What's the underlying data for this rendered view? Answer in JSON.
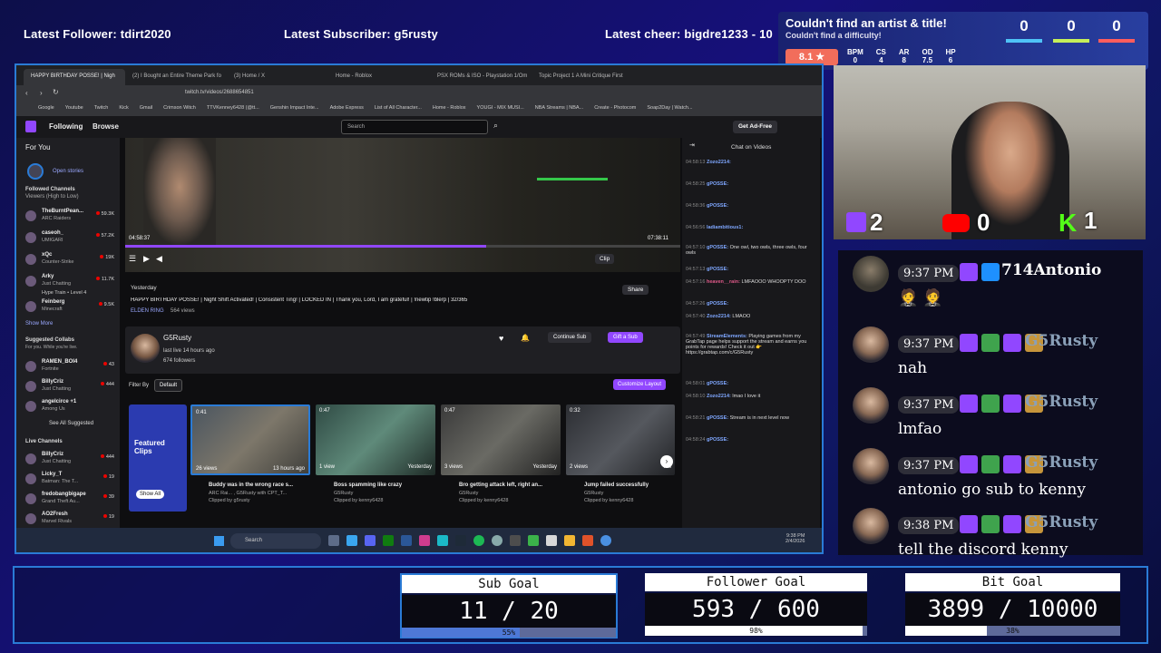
{
  "stream_overlay": {
    "latest_follower": "Latest Follower: tdirt2020",
    "latest_subscriber": "Latest Subscriber: g5rusty",
    "latest_cheer": "Latest cheer: bigdre1233 - 10"
  },
  "game_overlay": {
    "title": "Couldn't find an artist & title!",
    "subtitle": "Couldn't find a difficulty!",
    "star_rating": "8.1 ★",
    "stats": [
      {
        "label": "BPM",
        "value": "0"
      },
      {
        "label": "CS",
        "value": "4"
      },
      {
        "label": "AR",
        "value": "8"
      },
      {
        "label": "OD",
        "value": "7.5"
      },
      {
        "label": "HP",
        "value": "6"
      }
    ],
    "counters": [
      "0",
      "0",
      "0"
    ],
    "counter_colors": [
      "#4fc3f7",
      "#c6ef5a",
      "#ff5d5d"
    ]
  },
  "webcam_counters": {
    "twitch": "2",
    "youtube": "0",
    "kick": "1"
  },
  "browser": {
    "tabs": [
      "HAPPY BIRTHDAY POSSE! | Nigh",
      "(2) I Bought an Entire Theme Park fo",
      "(3) Home / X",
      "Home - Roblox",
      "PSX ROMs & ISO - Playstation 1/Om",
      "Topic Project 1 A Mini Critique First"
    ],
    "url": "twitch.tv/videos/2688654851",
    "bookmarks": [
      "Google",
      "Youtube",
      "Twitch",
      "Kick",
      "Gmail",
      "Crimson Witch",
      "TTVKenney6428 (@tt...",
      "Genshin Impact Inte...",
      "Adobe Express",
      "List of All Character...",
      "Home - Roblox",
      "YOUGI - MIX MUSI...",
      "NBA Streams | NBA...",
      "Create - Photocom",
      "Soap2Day | Watch..."
    ]
  },
  "twitch": {
    "nav": {
      "following": "Following",
      "browse": "Browse",
      "search_placeholder": "Search",
      "get_ad_free": "Get Ad-Free"
    },
    "sidebar": {
      "for_you": "For You",
      "open_stories": "Open stories",
      "followed_channels": "Followed Channels",
      "followed_sort": "Viewers (High to Low)",
      "followed": [
        {
          "name": "TheBurntPean...",
          "game": "ARC Raiders",
          "count": "59.3K"
        },
        {
          "name": "caseoh_",
          "game": "UMIGARI",
          "count": "57.2K"
        },
        {
          "name": "xQc",
          "game": "Counter-Strike",
          "count": "19K"
        },
        {
          "name": "Arky",
          "game": "Just Chatting",
          "count": "11.7K"
        },
        {
          "name": "Feinberg",
          "game": "Minecraft",
          "count": "9.5K"
        }
      ],
      "hype_train": "Hype Train • Level 4",
      "show_more": "Show More",
      "suggested_collabs": "Suggested Collabs",
      "suggested_sub": "For you. While you're live.",
      "suggested": [
        {
          "name": "RAMEN_BOI4",
          "game": "Fortnite",
          "count": "43"
        },
        {
          "name": "BillyCriz",
          "game": "Just Chatting",
          "count": "444"
        },
        {
          "name": "angelcirce +1",
          "game": "Among Us",
          "count": ""
        }
      ],
      "see_all_suggested": "See All Suggested",
      "live_channels": "Live Channels",
      "live": [
        {
          "name": "BillyCriz",
          "game": "Just Chatting",
          "count": "444"
        },
        {
          "name": "Licky_T",
          "game": "Batman: The T...",
          "count": "19"
        },
        {
          "name": "fredobangbigape",
          "game": "Grand Theft Au...",
          "count": "39"
        },
        {
          "name": "AO2Fresh",
          "game": "Marvel Rivals",
          "count": "19"
        }
      ]
    },
    "player": {
      "time_current": "04:58:37",
      "time_total": "07:38:11",
      "clip": "Clip"
    },
    "video": {
      "date": "Yesterday",
      "title": "HAPPY BIRTHDAY POSSE! | Night Shift Activated! | Consistent Ting! | LOCKED IN | Thank you, Lord, I am grateful! | !newtip !blerp | 32/365",
      "game": "ELDEN RING",
      "views": "564 views",
      "share": "Share"
    },
    "channel": {
      "name": "G5Rusty",
      "last_live": "last live 14 hours ago",
      "followers": "674 followers",
      "continue_sub": "Continue Sub",
      "gift_sub": "Gift a Sub"
    },
    "filter": {
      "label": "Filter By",
      "value": "Default",
      "customize": "Customize Layout"
    },
    "featured": {
      "label": "Featured Clips",
      "show_all": "Show All"
    },
    "clips": [
      {
        "duration": "0:41",
        "views": "26 views",
        "age": "13 hours ago",
        "title": "Buddy was in the wrong race s...",
        "meta": "ARC Rai... , G5Rusty with CPT_T...",
        "clipper": "Clipped by g5rusty"
      },
      {
        "duration": "0:47",
        "views": "1 view",
        "age": "Yesterday",
        "title": "Boss spamming like crazy",
        "meta": "G5Rusty",
        "clipper": "Clipped by kenny6428"
      },
      {
        "duration": "0:47",
        "views": "3 views",
        "age": "Yesterday",
        "title": "Bro getting attack left, right an...",
        "meta": "G5Rusty",
        "clipper": "Clipped by kenny6428"
      },
      {
        "duration": "0:32",
        "views": "2 views",
        "age": "Yes",
        "title": "Jump failed successfully",
        "meta": "G5Rusty",
        "clipper": "Clipped by kenny6428"
      }
    ],
    "chat": {
      "header": "Chat on Videos",
      "messages": [
        {
          "t": "04:58:13",
          "user": "Zozo2214:",
          "text": ""
        },
        {
          "t": "04:58:25",
          "user": "gPOSSE:",
          "text": ""
        },
        {
          "t": "04:58:36",
          "user": "gPOSSE:",
          "text": ""
        },
        {
          "t": "04:56:56",
          "user": "ladiambitious1:",
          "text": ""
        },
        {
          "t": "04:57:10",
          "user": "gPOSSE:",
          "text": "One owl, two owls, three owls, four owls"
        },
        {
          "t": "04:57:13",
          "user": "gPOSSE:",
          "text": ""
        },
        {
          "t": "04:57:16",
          "user": "heaven__rain:",
          "text": "LMFAOOO WHOOPTY DOO"
        },
        {
          "t": "04:57:26",
          "user": "gPOSSE:",
          "text": ""
        },
        {
          "t": "04:57:40",
          "user": "Zozo2214:",
          "text": "LMAOO"
        },
        {
          "t": "04:57:49",
          "user": "StreamElements:",
          "text": "Playing games from my GrabTap page helps support the stream and earns you points for rewards! Check it out 👉 https://grabtap.com/c/G5Rusty"
        },
        {
          "t": "04:58:01",
          "user": "gPOSSE:",
          "text": ""
        },
        {
          "t": "04:58:10",
          "user": "Zozo2214:",
          "text": "lmao I love it"
        },
        {
          "t": "04:58:21",
          "user": "gPOSSE:",
          "text": "Stream is in next level now"
        },
        {
          "t": "04:58:24",
          "user": "gPOSSE:",
          "text": ""
        }
      ]
    }
  },
  "taskbar": {
    "search": "Search",
    "time": "9:38 PM",
    "date": "2/4/2026"
  },
  "chat_overlay": [
    {
      "time": "9:37 PM",
      "name": "714Antonio",
      "text": "",
      "name_color": "#ffffff"
    },
    {
      "time": "9:37 PM",
      "name": "G5Rusty",
      "text": "nah",
      "name_color": "#8aa0b8"
    },
    {
      "time": "9:37 PM",
      "name": "G5Rusty",
      "text": "lmfao",
      "name_color": "#8aa0b8"
    },
    {
      "time": "9:37 PM",
      "name": "G5Rusty",
      "text": "antonio go sub to kenny",
      "name_color": "#8aa0b8"
    },
    {
      "time": "9:38 PM",
      "name": "G5Rusty",
      "text": "tell the discord kenny",
      "name_color": "#8aa0b8"
    }
  ],
  "goals": [
    {
      "title": "Sub Goal",
      "value": "11 / 20",
      "pct_label": "55%",
      "fraction": 0.55
    },
    {
      "title": "Follower Goal",
      "value": "593 / 600",
      "pct_label": "98%",
      "fraction": 0.98
    },
    {
      "title": "Bit Goal",
      "value": "3899 / 10000",
      "pct_label": "38%",
      "fraction": 0.38
    }
  ],
  "colors": {
    "twitch_purple": "#9147ff",
    "accent_blue": "#2a7bd6",
    "live_red": "#eb0400",
    "kick_green": "#53fc18"
  }
}
